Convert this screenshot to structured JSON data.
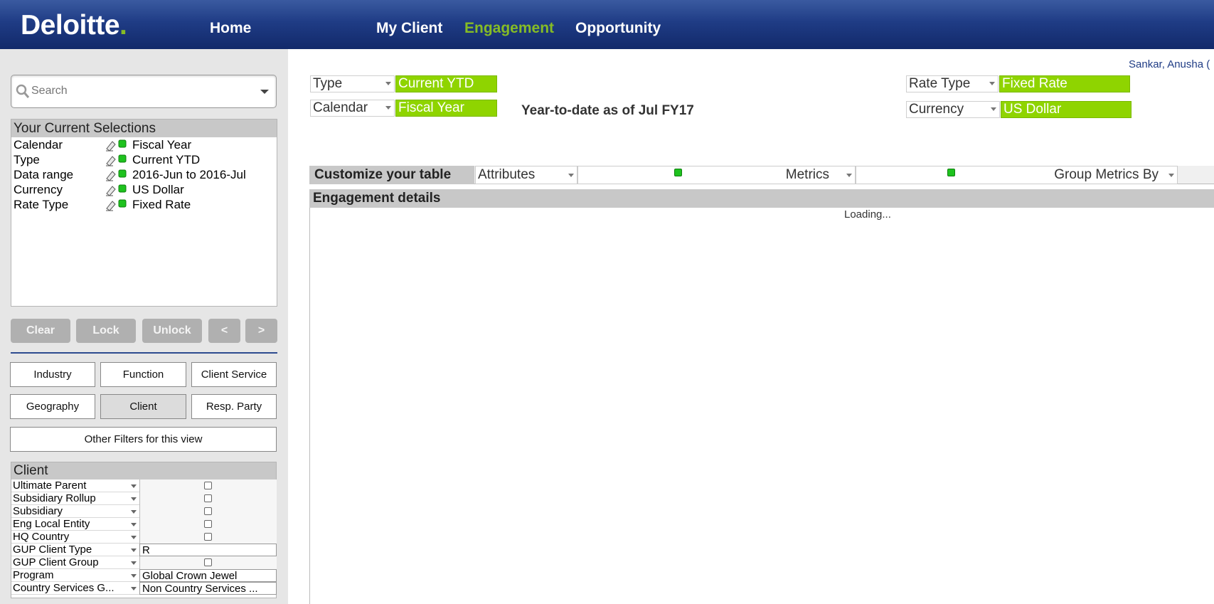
{
  "header": {
    "logo_text": "Deloitte",
    "logo_dot": ".",
    "nav": {
      "home": "Home",
      "my_client": "My Client",
      "engagement": "Engagement",
      "opportunity": "Opportunity"
    },
    "active_nav": "Engagement"
  },
  "sidebar": {
    "search_placeholder": "Search",
    "current_selections": {
      "title": "Your Current Selections",
      "items": [
        {
          "label": "Calendar",
          "value": "Fiscal Year"
        },
        {
          "label": "Type",
          "value": "Current YTD"
        },
        {
          "label": "Data range",
          "value": "2016-Jun to 2016-Jul"
        },
        {
          "label": "Currency",
          "value": "US Dollar"
        },
        {
          "label": "Rate Type",
          "value": "Fixed Rate"
        }
      ]
    },
    "buttons": {
      "clear": "Clear",
      "lock": "Lock",
      "unlock": "Unlock",
      "prev": "<",
      "next": ">"
    },
    "filters": {
      "industry": "Industry",
      "function": "Function",
      "client_service": "Client Service",
      "geography": "Geography",
      "client": "Client",
      "resp_party": "Resp. Party",
      "other": "Other Filters for this view"
    },
    "client_panel": {
      "title": "Client",
      "rows": [
        {
          "label": "Ultimate Parent",
          "value": ""
        },
        {
          "label": "Subsidiary Rollup",
          "value": ""
        },
        {
          "label": "Subsidiary",
          "value": ""
        },
        {
          "label": "Eng Local Entity",
          "value": ""
        },
        {
          "label": "HQ Country",
          "value": ""
        },
        {
          "label": "GUP Client Type",
          "value": "R"
        },
        {
          "label": "GUP Client Group",
          "value": ""
        },
        {
          "label": "Program",
          "value": "Global Crown Jewel"
        },
        {
          "label": "Country Services G...",
          "value": "Non Country Services ..."
        }
      ]
    }
  },
  "main": {
    "user_name": "Sankar, Anusha (",
    "type": {
      "label": "Type",
      "value": "Current YTD"
    },
    "calendar": {
      "label": "Calendar",
      "value": "Fiscal Year"
    },
    "rate_type": {
      "label": "Rate Type",
      "value": "Fixed Rate"
    },
    "currency": {
      "label": "Currency",
      "value": "US Dollar"
    },
    "ytd_text": "Year-to-date as of Jul FY17",
    "customize": {
      "title": "Customize your table",
      "attributes": "Attributes",
      "metrics": "Metrics",
      "group_metrics_by": "Group Metrics By"
    },
    "engagement_details": "Engagement details",
    "loading_text": "Loading..."
  },
  "colors": {
    "header_blue": "#1f3c85",
    "deloitte_green": "#86bc25",
    "value_green": "#8fd400",
    "indicator_green": "#1ec21e"
  }
}
